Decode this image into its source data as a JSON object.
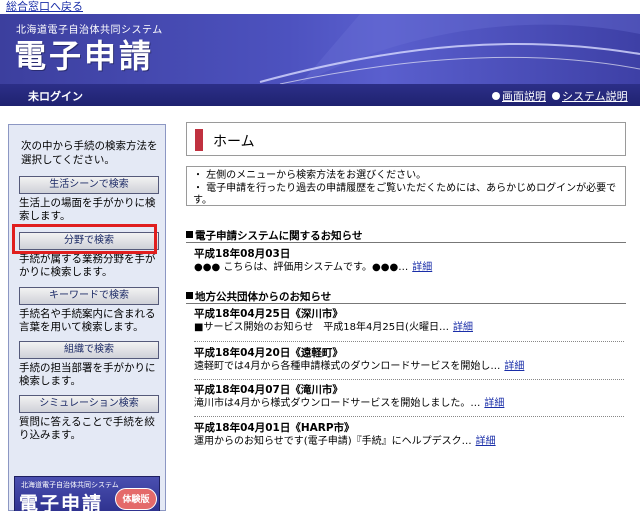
{
  "top_link": "総合窓口へ戻る",
  "header": {
    "system_subtitle": "北海道電子自治体共同システム",
    "system_title": "電子申請",
    "login_status": "未ログイン",
    "links": [
      "画面説明",
      "システム説明"
    ]
  },
  "sidebar": {
    "intro": "次の中から手続の検索方法を選択してください。",
    "buttons": [
      {
        "label": "生活シーンで検索",
        "desc": "生活上の場面を手がかりに検索します。"
      },
      {
        "label": "分野で検索",
        "desc": "手続が属する業務分野を手がかりに検索します。"
      },
      {
        "label": "キーワードで検索",
        "desc": "手続名や手続案内に含まれる言葉を用いて検索します。"
      },
      {
        "label": "組織で検索",
        "desc": "手続の担当部署を手がかりに検索します。"
      },
      {
        "label": "シミュレーション検索",
        "desc": "質問に答えることで手続を絞り込みます。"
      }
    ],
    "logo": {
      "subtitle": "北海道電子自治体共同システム",
      "title": "電子申請",
      "badge": "体験版"
    }
  },
  "main": {
    "title": "ホーム",
    "notices": [
      "・ 左側のメニューから検索方法をお選びください。",
      "・ 電子申請を行ったり過去の申請履歴をご覧いただくためには、あらかじめログインが必要で",
      "す。"
    ],
    "system_news_title": "電子申請システムに関するお知らせ",
    "system_news": [
      {
        "date": "平成18年08月03日",
        "text": "●●● こちらは、評価用システムです。●●●…",
        "link": "詳細"
      }
    ],
    "local_news_title": "地方公共団体からのお知らせ",
    "local_news": [
      {
        "date": "平成18年04月25日《深川市》",
        "text": "■サービス開始のお知らせ　平成18年4月25日(火曜日…",
        "link": "詳細"
      },
      {
        "date": "平成18年04月20日《遠軽町》",
        "text": "遠軽町では4月から各種申請様式のダウンロードサービスを開始し…",
        "link": "詳細"
      },
      {
        "date": "平成18年04月07日《滝川市》",
        "text": "滝川市は4月から様式ダウンロードサービスを開始しました。…",
        "link": "詳細"
      },
      {
        "date": "平成18年04月01日《HARP市》",
        "text": "運用からのお知らせです(電子申請)『手続』にヘルプデスク…",
        "link": "詳細"
      }
    ]
  },
  "colors": {
    "banner": "#4d52bf",
    "statusbar": "#23267a",
    "sidebar_bg": "#e4e9f5",
    "title_mark": "#c0313f",
    "highlight": "#e01e1e",
    "link": "#1a2ea8"
  }
}
